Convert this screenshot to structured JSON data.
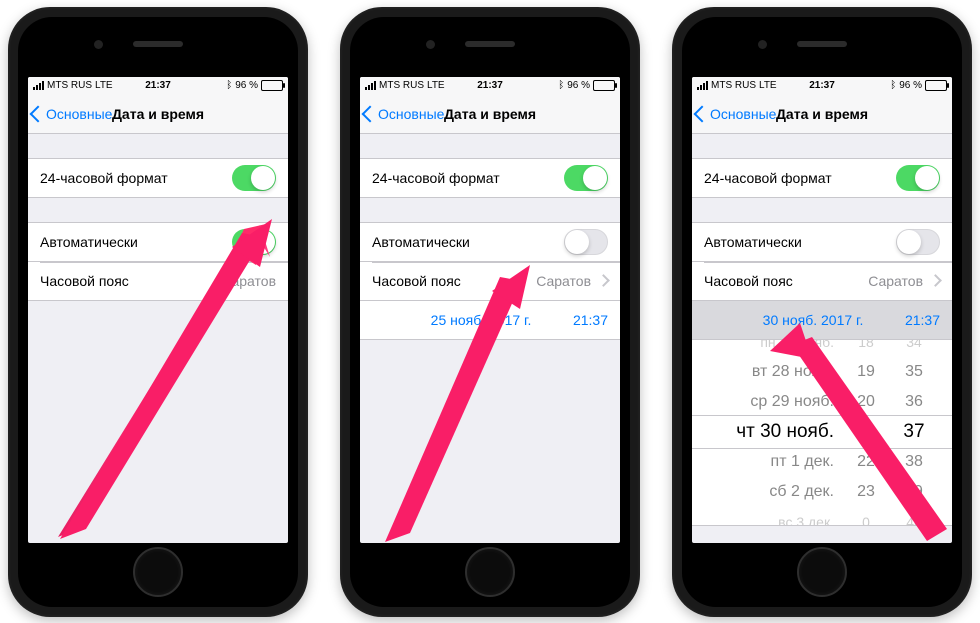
{
  "status": {
    "carrier": "MTS RUS",
    "net": "LTE",
    "time": "21:37",
    "battery_pct": "96 %"
  },
  "nav": {
    "back": "Основные",
    "title": "Дата и время"
  },
  "labels": {
    "format24h": "24-часовой формат",
    "automatic": "Автоматически",
    "timezone": "Часовой пояс"
  },
  "timezone_value": "Саратов",
  "phone2": {
    "date": "25 нояб. 2017 г.",
    "time": "21:37"
  },
  "phone3": {
    "date": "30 нояб. 2017 г.",
    "time": "21:37",
    "picker": {
      "dates": [
        "пн 27 нояб.",
        "вт 28 нояб.",
        "ср 29 нояб.",
        "чт 30 нояб.",
        "пт 1 дек.",
        "сб 2 дек.",
        "вс 3 дек."
      ],
      "hours": [
        "18",
        "19",
        "20",
        "21",
        "22",
        "23",
        "0"
      ],
      "mins": [
        "34",
        "35",
        "36",
        "37",
        "38",
        "39",
        "40"
      ]
    }
  }
}
